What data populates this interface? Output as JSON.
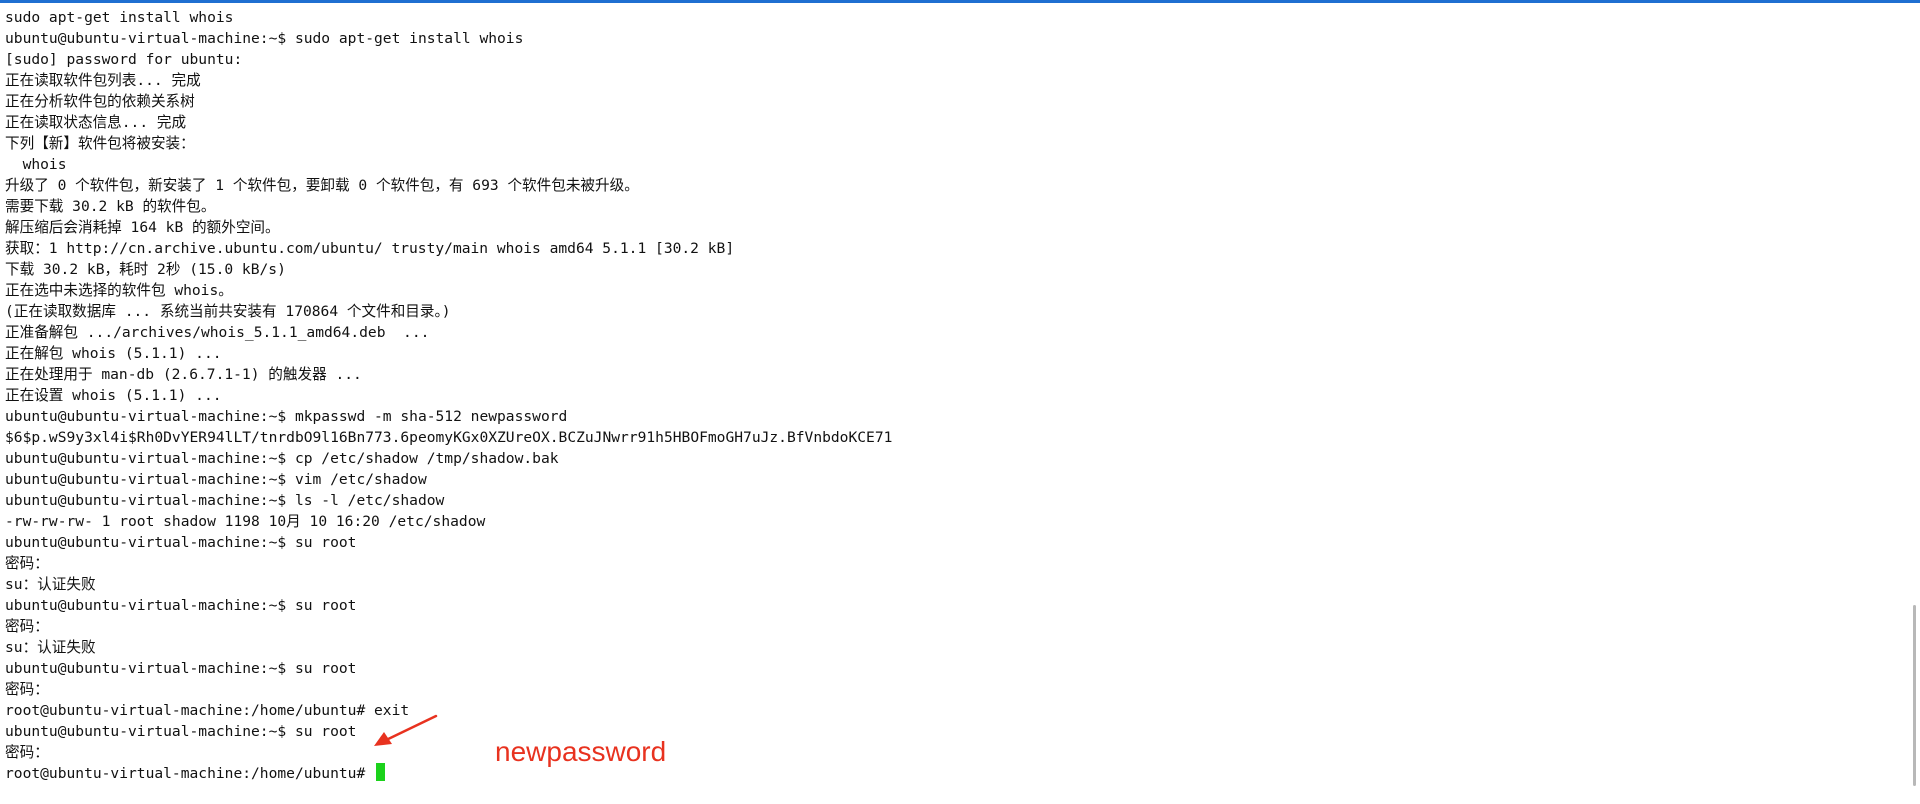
{
  "terminal": {
    "lines": [
      "sudo apt-get install whois",
      "ubuntu@ubuntu-virtual-machine:~$ sudo apt-get install whois",
      "[sudo] password for ubuntu:",
      "正在读取软件包列表... 完成",
      "正在分析软件包的依赖关系树",
      "正在读取状态信息... 完成",
      "下列【新】软件包将被安装：",
      "  whois",
      "升级了 0 个软件包，新安装了 1 个软件包，要卸载 0 个软件包，有 693 个软件包未被升级。",
      "需要下载 30.2 kB 的软件包。",
      "解压缩后会消耗掉 164 kB 的额外空间。",
      "获取：1 http://cn.archive.ubuntu.com/ubuntu/ trusty/main whois amd64 5.1.1 [30.2 kB]",
      "下载 30.2 kB，耗时 2秒 (15.0 kB/s)",
      "正在选中未选择的软件包 whois。",
      "(正在读取数据库 ... 系统当前共安装有 170864 个文件和目录。)",
      "正准备解包 .../archives/whois_5.1.1_amd64.deb  ...",
      "正在解包 whois (5.1.1) ...",
      "正在处理用于 man-db (2.6.7.1-1) 的触发器 ...",
      "正在设置 whois (5.1.1) ...",
      "ubuntu@ubuntu-virtual-machine:~$ mkpasswd -m sha-512 newpassword",
      "$6$p.wS9y3xl4i$Rh0DvYER94lLT/tnrdbO9l16Bn773.6peomyKGx0XZUreOX.BCZuJNwrr91h5HBOFmoGH7uJz.BfVnbdoKCE71",
      "ubuntu@ubuntu-virtual-machine:~$ cp /etc/shadow /tmp/shadow.bak",
      "ubuntu@ubuntu-virtual-machine:~$ vim /etc/shadow",
      "ubuntu@ubuntu-virtual-machine:~$ ls -l /etc/shadow",
      "-rw-rw-rw- 1 root shadow 1198 10月 10 16:20 /etc/shadow",
      "ubuntu@ubuntu-virtual-machine:~$ su root",
      "密码：",
      "su：认证失败",
      "ubuntu@ubuntu-virtual-machine:~$ su root",
      "密码：",
      "su：认证失败",
      "ubuntu@ubuntu-virtual-machine:~$ su root",
      "密码：",
      "root@ubuntu-virtual-machine:/home/ubuntu# exit",
      "ubuntu@ubuntu-virtual-machine:~$ su root",
      "密码：",
      "root@ubuntu-virtual-machine:/home/ubuntu# "
    ]
  },
  "annotation": {
    "label": "newpassword",
    "color": "#e8321f"
  },
  "cursor": {
    "color": "#1bd21b"
  }
}
